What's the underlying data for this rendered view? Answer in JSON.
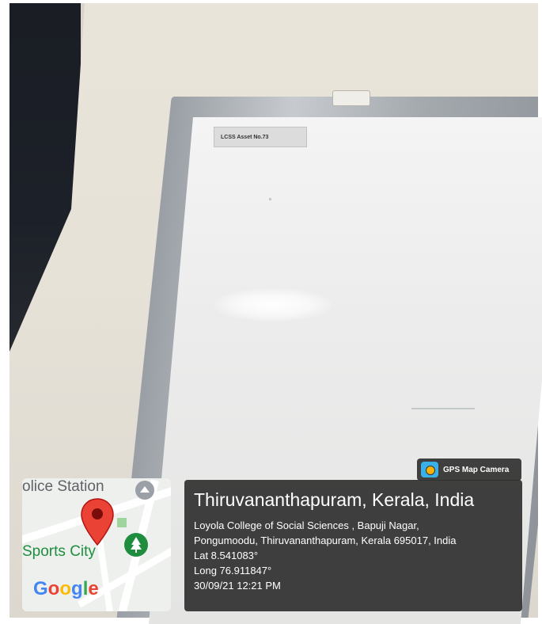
{
  "photo": {
    "asset_label": "LCSS Asset No.73"
  },
  "overlay": {
    "badge_label": "GPS Map Camera",
    "badge_icon": "camera-icon",
    "title": "Thiruvananthapuram, Kerala, India",
    "address_line1": "Loyola College of Social Sciences , Bapuji Nagar,",
    "address_line2": "Pongumoodu, Thiruvananthapuram, Kerala 695017, India",
    "lat": "Lat 8.541083°",
    "long": "Long 76.911847°",
    "datetime": "30/09/21 12:21 PM"
  },
  "map": {
    "police_label": "olice Station",
    "sports_label": "Sports City",
    "logo": {
      "letters": [
        "G",
        "o",
        "o",
        "g",
        "l",
        "e"
      ],
      "colors": [
        "#4285f4",
        "#ea4335",
        "#fbbc05",
        "#4285f4",
        "#34a853",
        "#ea4335"
      ]
    },
    "pin_color": "#ea4335",
    "park_color": "#1e8e3e",
    "police_marker_color": "#9aa0a6"
  }
}
